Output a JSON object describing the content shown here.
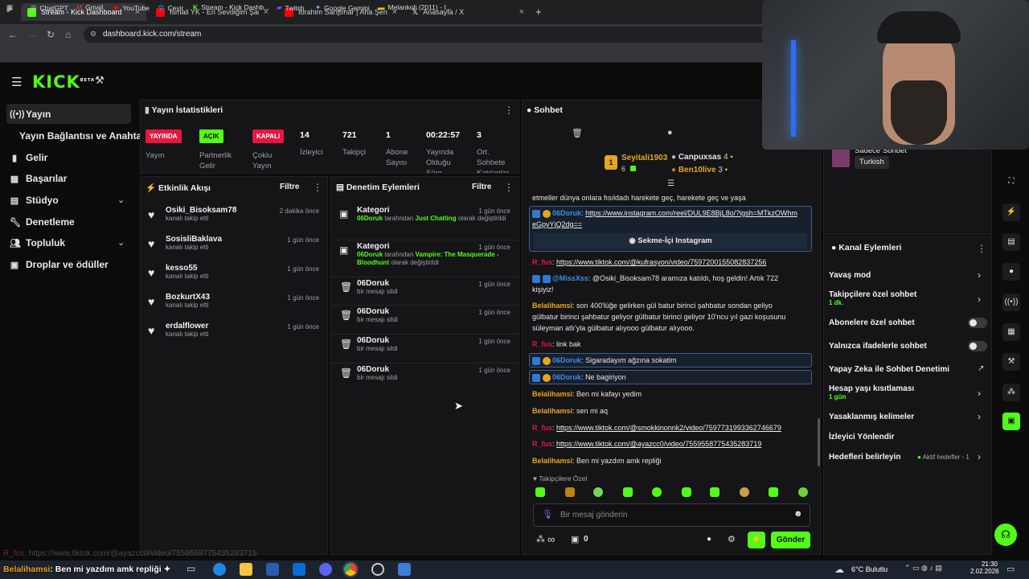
{
  "browser": {
    "tabs": [
      {
        "title": "Stream - Kick Dashboard",
        "active": true,
        "color": "#53fc18"
      },
      {
        "title": "İsmail YK - En Sevdiğim Şarkısı",
        "color": "#ff0000"
      },
      {
        "title": "İbrahim Sarıpınar | Aha Şenlik (",
        "color": "#ff0000"
      },
      {
        "title": "Anasayfa / X",
        "color": "#000000"
      }
    ],
    "new_tab": "+",
    "url": "dashboard.kick.com/stream",
    "bookmarks": [
      "ChatGPT",
      "Gmail",
      "YouTube",
      "Çevir",
      "Stream - Kick Dashb...",
      "Twitch",
      "Google Gemini",
      "Melankoli (2011) - I..."
    ]
  },
  "kick": {
    "logo": "KICK",
    "beta": "BETA"
  },
  "sidebar": {
    "items": [
      {
        "label": "Yayın",
        "icon": "broadcast-icon"
      },
      {
        "label": "Yayın Bağlantısı ve Anahtarı"
      },
      {
        "label": "Gelir",
        "icon": "chart-icon"
      },
      {
        "label": "Başarılar",
        "icon": "calendar-icon"
      },
      {
        "label": "Stüdyo",
        "icon": "studio-icon"
      },
      {
        "label": "Denetleme",
        "icon": "wrench-icon"
      },
      {
        "label": "Topluluk",
        "icon": "users-icon"
      },
      {
        "label": "Droplar ve ödüller",
        "icon": "gift-icon"
      }
    ]
  },
  "stats": {
    "title": "Yayın İstatistikleri",
    "badges": [
      {
        "text": "YAYINDA",
        "label": "Yayın",
        "color": "#e5173f"
      },
      {
        "text": "AÇIK",
        "label": "Partnerlik Gelir",
        "color": "#53fc18"
      },
      {
        "text": "KAPALI",
        "label": "Çoklu Yayın",
        "color": "#e5173f"
      }
    ],
    "values": [
      {
        "value": "14",
        "label": "İzleyici"
      },
      {
        "value": "721",
        "label": "Takipçi"
      },
      {
        "value": "1",
        "label": "Abone Sayısı"
      },
      {
        "value": "00:22:57",
        "label": "Yayında Olduğu Süre"
      },
      {
        "value": "3",
        "label": "Ort. Sohbete Katılanlar"
      }
    ]
  },
  "activity": {
    "title": "Etkinlik Akışı",
    "filter": "Filtre",
    "rows": [
      {
        "name": "Osiki_Bisoksam78",
        "sub": "kanalı takip etti",
        "time": "2 dakika önce"
      },
      {
        "name": "SosisliBaklava",
        "sub": "kanalı takip etti",
        "time": "1 gün önce"
      },
      {
        "name": "kesso55",
        "sub": "kanalı takip etti",
        "time": "1 gün önce"
      },
      {
        "name": "BozkurtX43",
        "sub": "kanalı takip etti",
        "time": "1 gün önce"
      },
      {
        "name": "erdalflower",
        "sub": "kanalı takip etti",
        "time": "1 gün önce"
      }
    ]
  },
  "moderation": {
    "title": "Denetim Eylemleri",
    "filter": "Filtre",
    "rows": [
      {
        "name": "Kategori",
        "by": "06Doruk",
        "mid": "tarafından",
        "value": "Just Chatting",
        "tail": "olarak değiştirildi",
        "time": "1 gün önce"
      },
      {
        "name": "Kategori",
        "by": "06Doruk",
        "mid": "tarafından",
        "value": "Vampire: The Masquerade - Bloodhunt",
        "tail": "olarak değiştirildi",
        "time": "1 gün önce"
      },
      {
        "name": "06Doruk",
        "sub": "bir mesajı sildi",
        "time": "1 gün önce"
      },
      {
        "name": "06Doruk",
        "sub": "bir mesajı sildi",
        "time": "1 gün önce"
      },
      {
        "name": "06Doruk",
        "sub": "bir mesajı sildi",
        "time": "1 gün önce"
      },
      {
        "name": "06Doruk",
        "sub": "bir mesajı sildi",
        "time": "1 gün önce"
      }
    ]
  },
  "chat": {
    "title": "Sohbet",
    "top": {
      "first": "Seyitali1903",
      "first_count": "6",
      "second": "Canpuxsas",
      "second_count": "4",
      "third": "Ben10live",
      "third_count": "3",
      "rank": "1"
    },
    "messages": [
      {
        "text": "etmeller dünya onlara fısıldadı harekete geç, harekete geç ve yaşa"
      },
      {
        "user": "06Doruk",
        "color": "#3b8de8",
        "link": "https://www.instagram.com/reel/DUL9E8BjL8o/?igsh=MTkzOWhmeGpyYjQ2dg==",
        "embed": "Sekme-İçi Instagram",
        "boxed": true
      },
      {
        "user": "R_fus",
        "color": "#e5173f",
        "link": "https://www.tiktok.com/@kufrasyon/video/7597200155082837256"
      },
      {
        "user": "@MissXss",
        "color": "#3b8de8",
        "text": "@Osiki_Bisoksam78 aramıza katıldı, hoş geldin! Artık 722 kişiyiz!"
      },
      {
        "user": "Belalihamsi",
        "color": "#e5a81c",
        "text": "son 400'lüğe gelirken gül batur birinci şahbatur sondan geliyo gülbatur birinci şahbatur geliyor gülbatur birinci geliyor 10'ncu yıl gazi koşusunu süleyman atlı'yla gülbatur alıyooo gülbatur alıyooo."
      },
      {
        "user": "R_fus",
        "color": "#e5173f",
        "text": "link bak"
      },
      {
        "user": "06Doruk",
        "color": "#3b8de8",
        "text": "Sigaradayım ağzına sokatim",
        "boxed": true
      },
      {
        "user": "06Doruk",
        "color": "#3b8de8",
        "text": "Ne bagiriyon",
        "boxed": true
      },
      {
        "user": "Belalihamsi",
        "color": "#e5a81c",
        "text": "Ben mi kafayı yedim"
      },
      {
        "user": "Belalihamsi",
        "color": "#e5a81c",
        "text": "sen mi aq"
      },
      {
        "user": "R_fus",
        "color": "#e5173f",
        "link": "https://www.tiktok.com/@smokkinonnk2/video/7597731993362746679"
      },
      {
        "user": "R_fus",
        "color": "#e5173f",
        "link": "https://www.tiktok.com/@ayazcc0/video/7559558775435283719"
      },
      {
        "user": "Belalihamsi",
        "color": "#e5a81c",
        "text": "Ben mi yazdım amk repliği"
      }
    ],
    "followers_only": "Takipçilere Özel",
    "input_placeholder": "Bir mesaj gönderin",
    "infinity": "∞",
    "count": "0",
    "send": "Gönder"
  },
  "right": {
    "chat_mode": "Sadece Sohbet",
    "language": "Turkish",
    "actions_title": "Kanal Eylemleri",
    "actions": [
      {
        "label": "Yavaş mod",
        "type": "arrow"
      },
      {
        "label": "Takipçilere özel sohbet",
        "sub": "1 dk.",
        "type": "arrow"
      },
      {
        "label": "Abonelere özel sohbet",
        "type": "toggle"
      },
      {
        "label": "Yalnızca ifadelerle sohbet",
        "type": "toggle"
      },
      {
        "label": "Yapay Zeka ile Sohbet Denetimi",
        "type": "external"
      },
      {
        "label": "Hesap yaşı kısıtlaması",
        "sub": "1 gün",
        "type": "arrow"
      },
      {
        "label": "Yasaklanmış kelimeler",
        "type": "arrow"
      },
      {
        "label": "İzleyici Yönlendir",
        "type": "none"
      },
      {
        "label": "Hedefleri belirleyin",
        "extra": "Aktif hedefler - 1",
        "type": "arrow"
      }
    ]
  },
  "overlay": {
    "line1_user": "R_fus",
    "line1_text": "https://www.tiktok.com/@ayazcc0/video/7559558775435283719",
    "line2_user": "Belalihamsi",
    "line2_text": "Ben mi yazdım amk repliği"
  },
  "taskbar": {
    "weather": "6°C Bulutlu",
    "time": "21:30",
    "date": "2.02.2026"
  }
}
